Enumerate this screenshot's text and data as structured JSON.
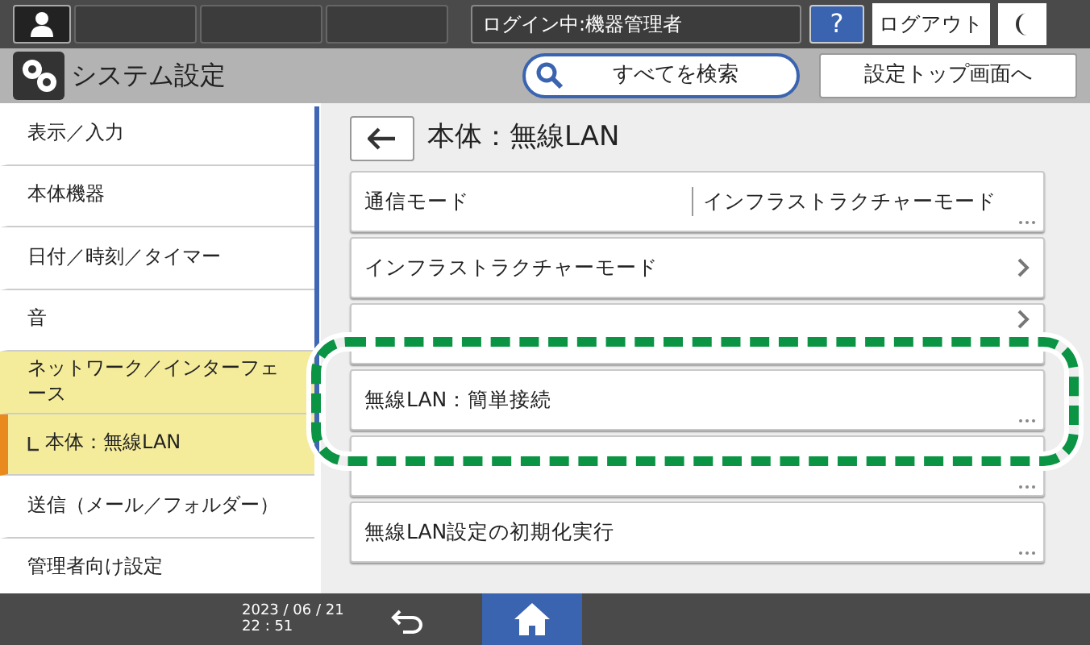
{
  "top_bar": {
    "login_status": "ログイン中:機器管理者",
    "help": "?",
    "logout": "ログアウト"
  },
  "header": {
    "title": "システム設定",
    "search": "すべてを検索",
    "top_button": "設定トップ画面へ"
  },
  "sidebar": {
    "items": [
      {
        "kind": "item",
        "label": "表示／入力",
        "expanded": false,
        "selected": false
      },
      {
        "kind": "item",
        "label": "本体機器",
        "expanded": false,
        "selected": false
      },
      {
        "kind": "item",
        "label": "日付／時刻／タイマー",
        "expanded": false,
        "selected": false
      },
      {
        "kind": "item",
        "label": "音",
        "expanded": false,
        "selected": false
      },
      {
        "kind": "item",
        "label": "ネットワーク／インターフェース",
        "expanded": true,
        "selected": false
      },
      {
        "kind": "subitem",
        "label": "本体：無線LAN",
        "expanded": false,
        "selected": true
      },
      {
        "kind": "item",
        "label": "送信（メール／フォルダー）",
        "expanded": false,
        "selected": false
      },
      {
        "kind": "item",
        "label": "管理者向け設定",
        "expanded": false,
        "selected": false
      }
    ]
  },
  "content": {
    "title": "本体：無線LAN",
    "rows": [
      {
        "kind": "value",
        "label": "通信モード",
        "value": "インフラストラクチャーモード"
      },
      {
        "kind": "link",
        "label": "インフラストラクチャーモード"
      },
      {
        "kind": "link"
      },
      {
        "kind": "option",
        "label": "無線LAN：簡単接続"
      },
      {
        "kind": "option"
      },
      {
        "kind": "option",
        "label": "無線LAN設定の初期化実行"
      }
    ]
  },
  "footer": {
    "date": "2023 / 06 / 21",
    "time": "22 : 51"
  }
}
